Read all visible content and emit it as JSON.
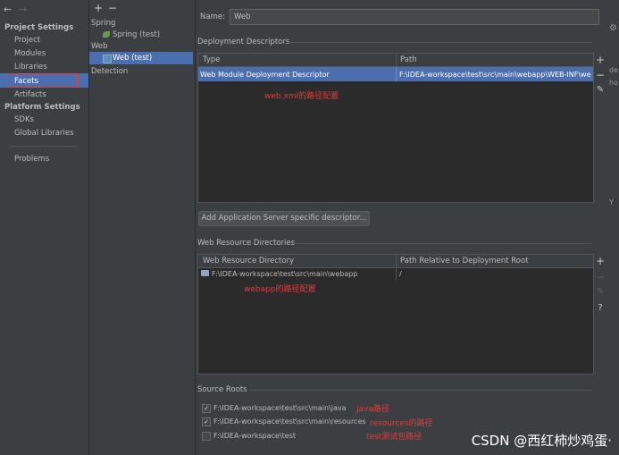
{
  "left_panel": {
    "project_settings_title": "Project Settings",
    "project_items": [
      "Project",
      "Modules",
      "Libraries",
      "Facets",
      "Artifacts"
    ],
    "platform_settings_title": "Platform Settings",
    "platform_items": [
      "SDKs",
      "Global Libraries"
    ],
    "problems": "Problems"
  },
  "middle_panel": {
    "add": "+",
    "remove": "−",
    "spring_group": "Spring",
    "spring_item": "Spring (test)",
    "web_group": "Web",
    "web_item": "Web (test)",
    "detection": "Detection"
  },
  "right_panel": {
    "name_label": "Name:",
    "name_value": "Web",
    "deployment_descriptors_title": "Deployment Descriptors",
    "dd_table": {
      "headers": [
        "Type",
        "Path"
      ],
      "row": {
        "type": "Web Module Deployment Descriptor",
        "path": "F:\\IDEA-workspace\\test\\src\\main\\webapp\\WEB-INF\\web"
      }
    },
    "dd_annotation": "web.xml的路径配置",
    "add_server_descriptor_button": "Add Application Server specific descriptor...",
    "web_resource_title": "Web Resource Directories",
    "wr_table": {
      "headers": [
        "Web Resource Directory",
        "Path Relative to Deployment Root"
      ],
      "row": {
        "dir": "F:\\IDEA-workspace\\test\\src\\main\\webapp",
        "rel": "/"
      }
    },
    "wr_annotation": "webapp的路径配置",
    "source_roots_title": "Source Roots",
    "source_roots": [
      {
        "path": "F:\\IDEA-workspace\\test\\src\\main\\java",
        "checked": true,
        "note": "java路径"
      },
      {
        "path": "F:\\IDEA-workspace\\test\\src\\main\\resources",
        "checked": true,
        "note": "resources的路径"
      },
      {
        "path": "F:\\IDEA-workspace\\test",
        "checked": false,
        "note": "test测试包路径"
      }
    ],
    "side_buttons": {
      "add": "+",
      "remove": "−",
      "edit": "✎",
      "help": "?"
    }
  },
  "edge_fragments": {
    "gear": "⚙",
    "de": "de",
    "ho": "ho",
    "y": "Y"
  },
  "watermark": "CSDN @西红柿炒鸡蛋·",
  "colors": {
    "selection": "#4b6eaf",
    "annotation": "#e03c3c",
    "highlight_box": "#e0413c",
    "background": "#3c3f41"
  }
}
